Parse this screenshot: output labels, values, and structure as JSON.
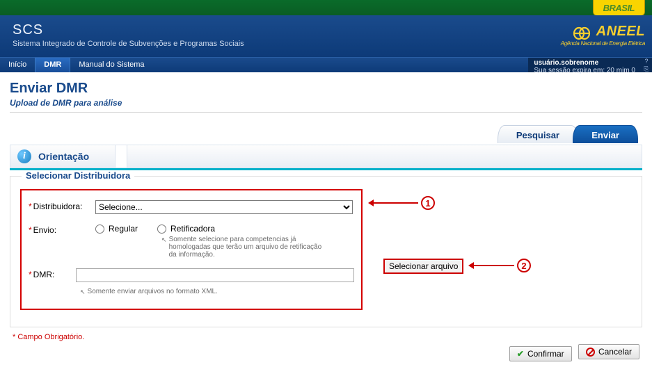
{
  "topbar": {
    "brasil": "BRASIL"
  },
  "header": {
    "title": "SCS",
    "subtitle": "Sistema Integrado de Controle de Subvenções e Programas Sociais",
    "logo_text": "ANEEL",
    "logo_sub": "Agência Nacional de Energia Elétrica"
  },
  "nav": {
    "items": [
      "Início",
      "DMR",
      "Manual do Sistema"
    ],
    "active_index": 1
  },
  "session": {
    "user": "usuário.sobrenome",
    "expires": "Sua sessão expira em: 20 mim 0"
  },
  "page": {
    "title": "Enviar DMR",
    "subtitle": "Upload de DMR para análise"
  },
  "tabs": {
    "search": "Pesquisar",
    "send": "Enviar"
  },
  "panel": {
    "orientacao": "Orientação"
  },
  "fieldset": {
    "legend": "Selecionar Distribuidora"
  },
  "form": {
    "distribuidora_label": "Distribuidora:",
    "distribuidora_placeholder": "Selecione...",
    "envio_label": "Envio:",
    "envio_regular": "Regular",
    "envio_retificadora": "Retificadora",
    "retificadora_hint": "Somente selecione para competencias já homologadas que terão um arquivo de retificação da informação.",
    "dmr_label": "DMR:",
    "dmr_hint": "Somente enviar arquivos no formato XML.",
    "selecionar_arquivo": "Selecionar arquivo"
  },
  "callouts": {
    "one": "1",
    "two": "2"
  },
  "footer": {
    "required_note": "* Campo Obrigatório.",
    "confirm": "Confirmar",
    "cancel": "Cancelar"
  }
}
